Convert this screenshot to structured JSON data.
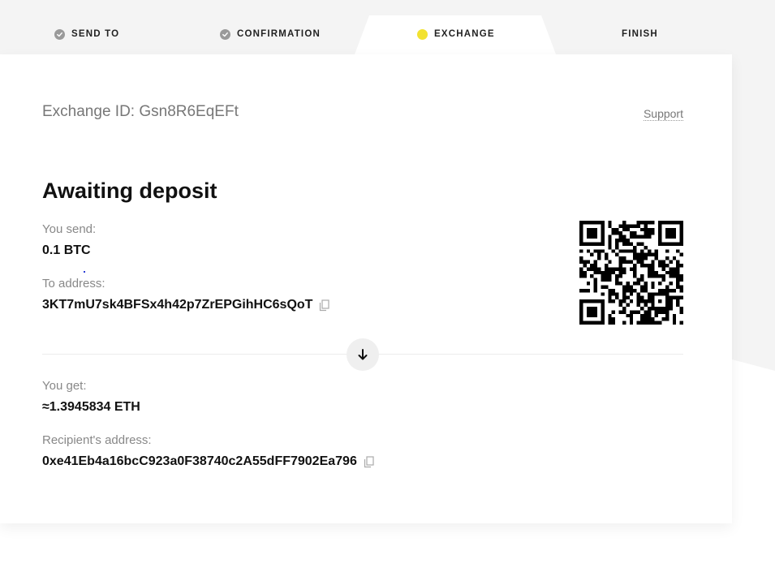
{
  "stepper": {
    "steps": [
      {
        "label": "SEND TO",
        "state": "done"
      },
      {
        "label": "CONFIRMATION",
        "state": "done"
      },
      {
        "label": "EXCHANGE",
        "state": "active"
      },
      {
        "label": "FINISH",
        "state": "pending"
      }
    ]
  },
  "header": {
    "exchange_id_label": "Exchange ID:",
    "exchange_id_value": "Gsn8R6EqEFt",
    "support_label": "Support"
  },
  "status": {
    "title": "Awaiting deposit"
  },
  "send": {
    "label": "You send:",
    "amount": "0.1 BTC",
    "address_label": "To address:",
    "address": "3KT7mU7sk4BFSx4h42p7ZrEPGihHC6sQoT"
  },
  "receive": {
    "label": "You get:",
    "amount": "≈1.3945834 ETH",
    "address_label": "Recipient's address:",
    "address": "0xe41Eb4a16bcC923a0F38740c2A55dFF7902Ea796"
  },
  "icons": {
    "step_done": "check-circle-icon",
    "step_active": "yellow-dot-icon",
    "copy": "copy-icon",
    "arrow": "arrow-down-icon",
    "qr": "qr-code"
  },
  "colors": {
    "accent_yellow": "#f2e230",
    "done_gray": "#9a9a9a",
    "page_bg": "#f4f4f4",
    "card_bg": "#ffffff"
  }
}
